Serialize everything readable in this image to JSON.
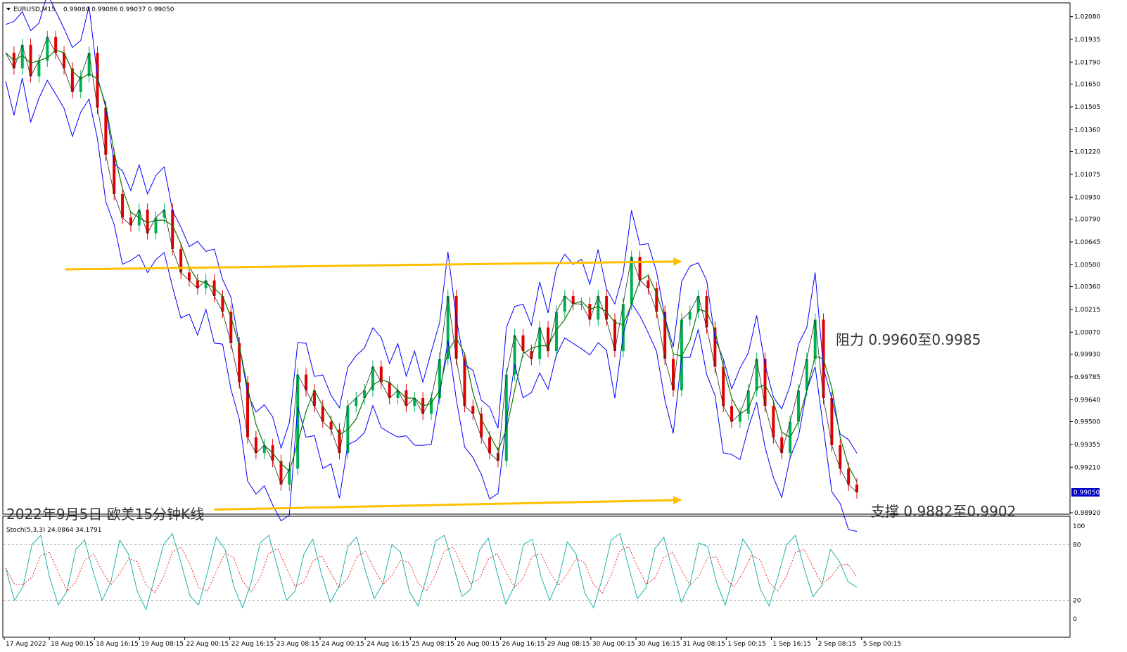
{
  "header": {
    "symbol": "EURUSD,M15",
    "ohlc": "0.99084 0.99086 0.99037 0.99050"
  },
  "indicator": {
    "label": "Stoch(5,3,3) 24.0864 34.1791",
    "levels": [
      "100",
      "80",
      "20",
      "0"
    ],
    "values": [
      55,
      20,
      35,
      80,
      90,
      45,
      15,
      30,
      75,
      85,
      50,
      20,
      40,
      85,
      70,
      30,
      10,
      45,
      80,
      92,
      60,
      25,
      15,
      50,
      88,
      75,
      35,
      12,
      40,
      82,
      90,
      55,
      20,
      30,
      70,
      86,
      48,
      18,
      35,
      78,
      88,
      52,
      22,
      38,
      80,
      72,
      30,
      14,
      46,
      84,
      90,
      58,
      24,
      32,
      74,
      87,
      50,
      16,
      36,
      80,
      86,
      46,
      20,
      42,
      83,
      70,
      28,
      12,
      44,
      85,
      92,
      56,
      22,
      34,
      76,
      88,
      52,
      18,
      38,
      82,
      78,
      40,
      15,
      48,
      86,
      72,
      32,
      14,
      45,
      80,
      90,
      54,
      24,
      36,
      75,
      62,
      40,
      34
    ]
  },
  "annotations": {
    "title": "2022年9月5日 欧美15分钟K线",
    "resistance": "阻力 0.9960至0.9985",
    "support": "支撑 0.9882至0.9902"
  },
  "colors": {
    "price_line": "#0000ff",
    "ma_line": "#0a7a00",
    "up_candle": "#00b050",
    "down_candle": "#e00000",
    "trend_line": "#ffc000",
    "stoch_main": "#20b2aa",
    "stoch_signal": "#e03030",
    "current_price_box": "#0000cc"
  },
  "chart_data": {
    "type": "line",
    "symbol": "EURUSD",
    "timeframe": "M15",
    "y_ticks": [
      "1.02080",
      "1.01935",
      "1.01790",
      "1.01650",
      "1.01505",
      "1.01360",
      "1.01220",
      "1.01075",
      "1.00930",
      "1.00790",
      "1.00645",
      "1.00500",
      "1.00360",
      "1.00215",
      "1.00070",
      "0.99930",
      "0.99785",
      "0.99640",
      "0.99500",
      "0.99355",
      "0.99210",
      "0.98920"
    ],
    "current_price": "0.99050",
    "x_ticks": [
      "17 Aug 2022",
      "18 Aug 00:15",
      "18 Aug 16:15",
      "19 Aug 08:15",
      "22 Aug 00:15",
      "22 Aug 16:15",
      "23 Aug 08:15",
      "24 Aug 00:15",
      "24 Aug 16:15",
      "25 Aug 08:15",
      "26 Aug 00:15",
      "26 Aug 16:15",
      "29 Aug 08:15",
      "30 Aug 00:15",
      "30 Aug 16:15",
      "31 Aug 08:15",
      "1 Sep 00:15",
      "1 Sep 16:15",
      "2 Sep 08:15",
      "5 Sep 00:15"
    ],
    "ylim": [
      0.9892,
      1.0215
    ],
    "series": [
      {
        "values": [
          1.0185,
          1.0175,
          1.019,
          1.017,
          1.018,
          1.0195,
          1.0185,
          1.0175,
          1.016,
          1.017,
          1.0185,
          1.015,
          1.012,
          1.0095,
          1.008,
          1.0075,
          1.0085,
          1.007,
          1.008,
          1.0085,
          1.006,
          1.0045,
          1.004,
          1.0035,
          1.004,
          1.003,
          1.002,
          1.0,
          0.9975,
          0.994,
          0.993,
          0.9935,
          0.9925,
          0.991,
          0.992,
          0.998,
          0.997,
          0.996,
          0.995,
          0.9945,
          0.993,
          0.996,
          0.9965,
          0.997,
          0.9985,
          0.9975,
          0.9965,
          0.997,
          0.996,
          0.9965,
          0.9955,
          0.9965,
          0.999,
          1.003,
          0.999,
          0.996,
          0.9955,
          0.994,
          0.993,
          0.9925,
          0.998,
          1.0005,
          0.9995,
          0.999,
          1.001,
          0.9995,
          1.002,
          1.003,
          1.0025,
          1.0025,
          1.0015,
          1.003,
          1.0015,
          0.9995,
          1.0025,
          1.0055,
          1.004,
          1.0035,
          1.002,
          0.999,
          0.997,
          1.0015,
          1.002,
          1.003,
          1.001,
          0.9985,
          0.996,
          0.995,
          0.9955,
          0.997,
          0.999,
          0.996,
          0.994,
          0.993,
          0.995,
          0.997,
          0.999,
          1.0015,
          0.9965,
          0.9935,
          0.992,
          0.991,
          0.9905
        ]
      }
    ],
    "lines": [
      {
        "name": "resistance",
        "from": [
          0.07,
          1.0047
        ],
        "to": [
          0.785,
          1.0052
        ]
      },
      {
        "name": "support",
        "from": [
          0.245,
          0.9894
        ],
        "to": [
          0.785,
          0.99
        ]
      }
    ]
  }
}
